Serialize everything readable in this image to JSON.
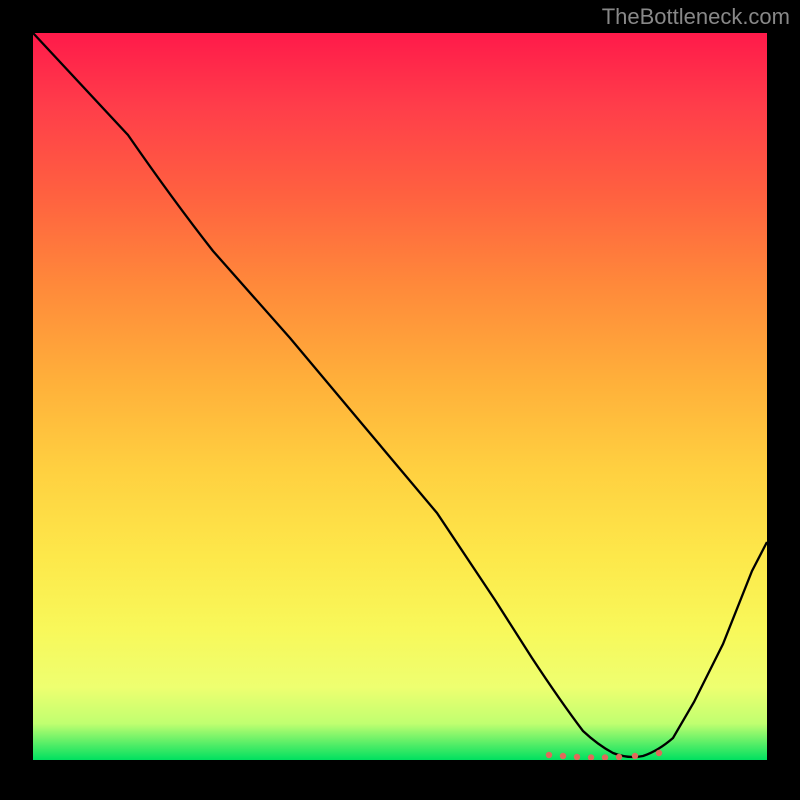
{
  "watermark": "TheBottleneck.com",
  "chart_data": {
    "type": "line",
    "title": "",
    "xlabel": "",
    "ylabel": "",
    "xlim": [
      0,
      100
    ],
    "ylim": [
      0,
      100
    ],
    "series": [
      {
        "name": "bottleneck-curve",
        "x": [
          0,
          13,
          19,
          25,
          35,
          45,
          55,
          63,
          68,
          72,
          75,
          77,
          80,
          83,
          86,
          90,
          94,
          98,
          100
        ],
        "values": [
          100,
          86,
          77,
          70,
          58,
          46,
          34,
          22,
          14,
          8,
          4,
          2,
          0.5,
          0.5,
          2,
          8,
          16,
          25,
          30
        ]
      }
    ],
    "markers": {
      "name": "highlight-region",
      "x": [
        70,
        72,
        74,
        76,
        78,
        80,
        82,
        85
      ],
      "values": [
        0.7,
        0.7,
        0.7,
        0.7,
        0.7,
        0.7,
        0.7,
        0.7
      ]
    },
    "gradient_stops": [
      {
        "pos": 0,
        "color": "#ff1a4a"
      },
      {
        "pos": 50,
        "color": "#ffc040"
      },
      {
        "pos": 85,
        "color": "#f8f85a"
      },
      {
        "pos": 100,
        "color": "#00e060"
      }
    ]
  }
}
